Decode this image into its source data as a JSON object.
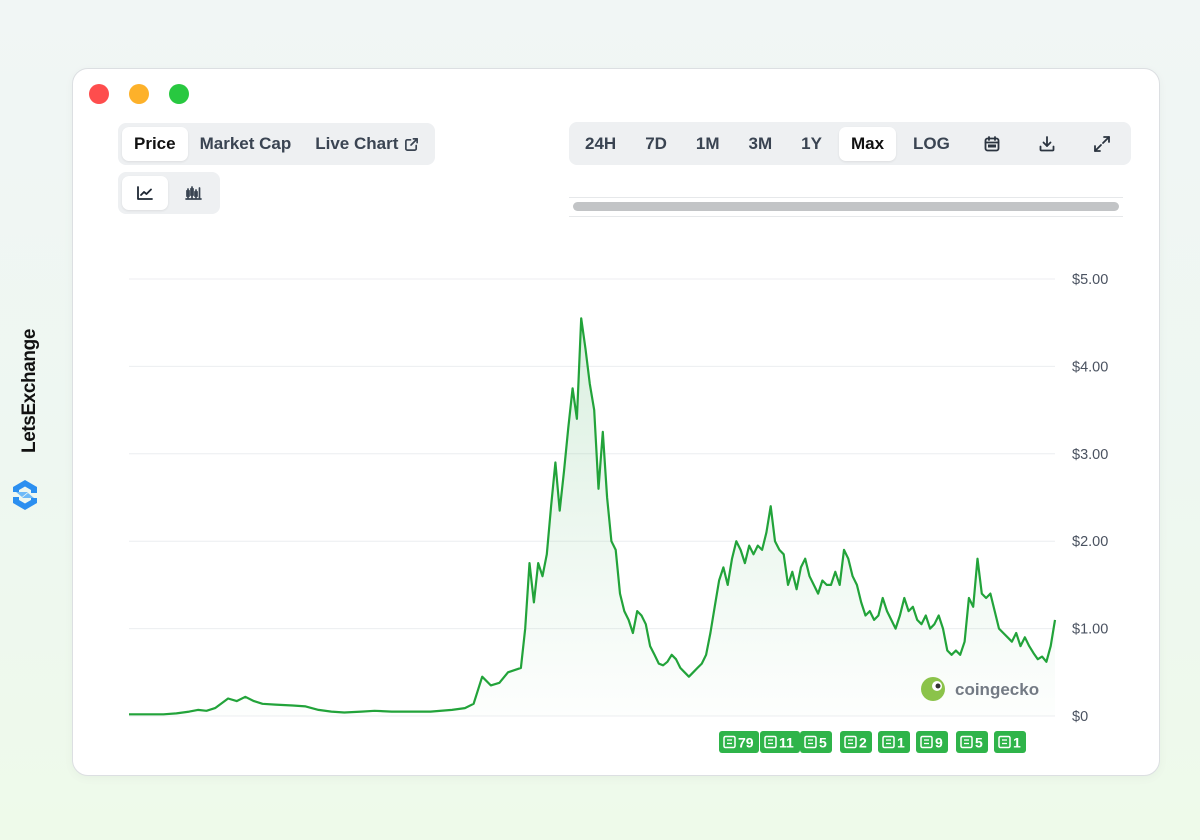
{
  "brand": {
    "name": "LetsExchange"
  },
  "window": {
    "controls": [
      "close",
      "minimize",
      "maximize"
    ]
  },
  "tabs": {
    "price": "Price",
    "market_cap": "Market Cap",
    "live_chart": "Live Chart"
  },
  "chart_types": {
    "line": "line-chart-icon",
    "candle": "candlestick-chart-icon",
    "active": "line"
  },
  "ranges": [
    "24H",
    "7D",
    "1M",
    "3M",
    "1Y",
    "Max",
    "LOG"
  ],
  "active_range": "Max",
  "toolbar_icons": [
    "calendar-icon",
    "download-icon",
    "expand-icon"
  ],
  "watermark": "coingecko",
  "colors": {
    "line": "#22a33a",
    "badge": "#2fb44a",
    "brand_blue": "#2b8ff0"
  },
  "news_badges": [
    "79",
    "11",
    "5",
    "2",
    "1",
    "9",
    "5",
    "1"
  ],
  "chart_data": {
    "type": "area",
    "x_index_range": [
      0,
      100
    ],
    "y_ticks": [
      "$0",
      "$1.00",
      "$2.00",
      "$3.00",
      "$4.00",
      "$5.00"
    ],
    "ylim": [
      0,
      5
    ],
    "grid": true,
    "series": [
      {
        "values": [
          [
            0,
            0.02
          ],
          [
            2,
            0.02
          ],
          [
            4,
            0.02
          ],
          [
            5.5,
            0.03
          ],
          [
            7,
            0.05
          ],
          [
            8,
            0.07
          ],
          [
            9,
            0.06
          ],
          [
            10,
            0.09
          ],
          [
            11.5,
            0.2
          ],
          [
            12.5,
            0.17
          ],
          [
            13.5,
            0.22
          ],
          [
            14.5,
            0.17
          ],
          [
            15.5,
            0.14
          ],
          [
            17,
            0.13
          ],
          [
            19,
            0.12
          ],
          [
            20.5,
            0.11
          ],
          [
            22,
            0.07
          ],
          [
            23.5,
            0.05
          ],
          [
            25,
            0.04
          ],
          [
            27,
            0.05
          ],
          [
            28.5,
            0.06
          ],
          [
            30.5,
            0.05
          ],
          [
            32.5,
            0.05
          ],
          [
            35,
            0.05
          ],
          [
            37.5,
            0.07
          ],
          [
            39,
            0.09
          ],
          [
            40,
            0.14
          ],
          [
            41,
            0.45
          ],
          [
            42,
            0.35
          ],
          [
            43,
            0.38
          ],
          [
            44,
            0.5
          ],
          [
            45.5,
            0.55
          ],
          [
            46,
            1.0
          ],
          [
            46.5,
            1.75
          ],
          [
            47,
            1.3
          ],
          [
            47.5,
            1.75
          ],
          [
            48,
            1.6
          ],
          [
            48.5,
            1.85
          ],
          [
            49,
            2.4
          ],
          [
            49.5,
            2.9
          ],
          [
            50,
            2.35
          ],
          [
            50.5,
            2.8
          ],
          [
            51,
            3.3
          ],
          [
            51.5,
            3.75
          ],
          [
            52,
            3.4
          ],
          [
            52.5,
            4.55
          ],
          [
            53,
            4.2
          ],
          [
            53.5,
            3.8
          ],
          [
            54,
            3.5
          ],
          [
            54.5,
            2.6
          ],
          [
            55,
            3.25
          ],
          [
            55.5,
            2.5
          ],
          [
            56,
            2.0
          ],
          [
            56.5,
            1.9
          ],
          [
            57,
            1.4
          ],
          [
            57.5,
            1.2
          ],
          [
            58,
            1.1
          ],
          [
            58.5,
            0.95
          ],
          [
            59,
            1.2
          ],
          [
            59.5,
            1.15
          ],
          [
            60,
            1.05
          ],
          [
            60.5,
            0.8
          ],
          [
            61,
            0.7
          ],
          [
            61.5,
            0.6
          ],
          [
            62,
            0.58
          ],
          [
            62.5,
            0.62
          ],
          [
            63,
            0.7
          ],
          [
            63.5,
            0.65
          ],
          [
            64,
            0.55
          ],
          [
            64.5,
            0.5
          ],
          [
            65,
            0.45
          ],
          [
            65.5,
            0.5
          ],
          [
            66,
            0.55
          ],
          [
            66.5,
            0.6
          ],
          [
            67,
            0.7
          ],
          [
            67.5,
            0.95
          ],
          [
            68,
            1.25
          ],
          [
            68.5,
            1.55
          ],
          [
            69,
            1.7
          ],
          [
            69.5,
            1.5
          ],
          [
            70,
            1.8
          ],
          [
            70.5,
            2.0
          ],
          [
            71,
            1.9
          ],
          [
            71.5,
            1.75
          ],
          [
            72,
            1.95
          ],
          [
            72.5,
            1.85
          ],
          [
            73,
            1.95
          ],
          [
            73.5,
            1.9
          ],
          [
            74,
            2.1
          ],
          [
            74.5,
            2.4
          ],
          [
            75,
            2.0
          ],
          [
            75.5,
            1.9
          ],
          [
            76,
            1.85
          ],
          [
            76.5,
            1.5
          ],
          [
            77,
            1.65
          ],
          [
            77.5,
            1.45
          ],
          [
            78,
            1.7
          ],
          [
            78.5,
            1.8
          ],
          [
            79,
            1.6
          ],
          [
            79.5,
            1.5
          ],
          [
            80,
            1.4
          ],
          [
            80.5,
            1.55
          ],
          [
            81,
            1.5
          ],
          [
            81.5,
            1.5
          ],
          [
            82,
            1.65
          ],
          [
            82.5,
            1.5
          ],
          [
            83,
            1.9
          ],
          [
            83.5,
            1.8
          ],
          [
            84,
            1.6
          ],
          [
            84.5,
            1.5
          ],
          [
            85,
            1.3
          ],
          [
            85.5,
            1.15
          ],
          [
            86,
            1.2
          ],
          [
            86.5,
            1.1
          ],
          [
            87,
            1.15
          ],
          [
            87.5,
            1.35
          ],
          [
            88,
            1.2
          ],
          [
            88.5,
            1.1
          ],
          [
            89,
            1.0
          ],
          [
            89.5,
            1.15
          ],
          [
            90,
            1.35
          ],
          [
            90.5,
            1.2
          ],
          [
            91,
            1.25
          ],
          [
            91.5,
            1.1
          ],
          [
            92,
            1.05
          ],
          [
            92.5,
            1.15
          ],
          [
            93,
            1.0
          ],
          [
            93.5,
            1.05
          ],
          [
            94,
            1.15
          ],
          [
            94.5,
            1.0
          ],
          [
            95,
            0.75
          ],
          [
            95.5,
            0.7
          ],
          [
            96,
            0.75
          ],
          [
            96.5,
            0.7
          ],
          [
            97,
            0.85
          ],
          [
            97.5,
            1.35
          ],
          [
            98,
            1.25
          ],
          [
            98.5,
            1.8
          ],
          [
            99,
            1.4
          ],
          [
            99.5,
            1.35
          ],
          [
            100,
            1.4
          ],
          [
            100.5,
            1.2
          ],
          [
            101,
            1.0
          ],
          [
            101.5,
            0.95
          ],
          [
            102,
            0.9
          ],
          [
            102.5,
            0.85
          ],
          [
            103,
            0.95
          ],
          [
            103.5,
            0.8
          ],
          [
            104,
            0.9
          ],
          [
            104.5,
            0.8
          ],
          [
            105,
            0.72
          ],
          [
            105.5,
            0.65
          ],
          [
            106,
            0.68
          ],
          [
            106.5,
            0.62
          ],
          [
            107,
            0.8
          ],
          [
            107.5,
            1.1
          ]
        ]
      }
    ]
  }
}
